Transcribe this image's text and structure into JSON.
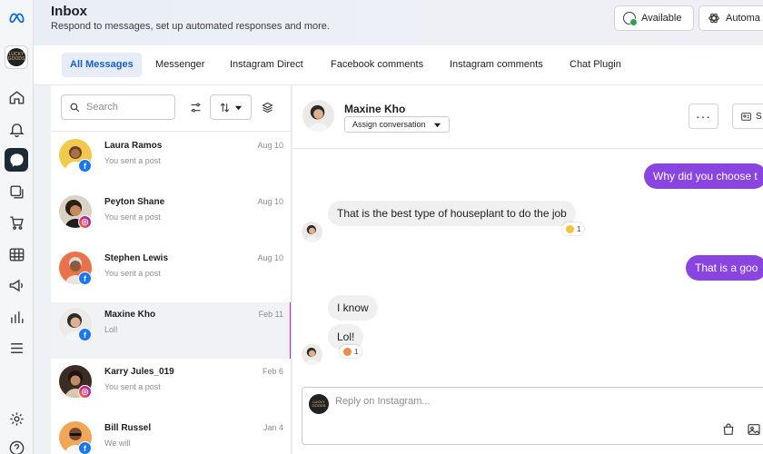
{
  "header": {
    "title": "Inbox",
    "subtitle": "Respond to messages, set up automated responses and more.",
    "available_label": "Available",
    "automations_label": "Automa"
  },
  "sidebar": {
    "brand_avatar_text": "LUCKY GOODS",
    "items": [
      "meta-logo",
      "home",
      "notifications",
      "inbox",
      "posts",
      "shop",
      "planner",
      "ads",
      "insights",
      "menu",
      "settings",
      "help"
    ]
  },
  "tabs": [
    {
      "label": "All Messages",
      "active": true
    },
    {
      "label": "Messenger"
    },
    {
      "label": "Instagram Direct"
    },
    {
      "label": "Facebook comments"
    },
    {
      "label": "Instagram comments"
    },
    {
      "label": "Chat Plugin"
    }
  ],
  "list": {
    "search_placeholder": "Search",
    "conversations": [
      {
        "name": "Laura Ramos",
        "preview": "You sent a post",
        "date": "Aug 10",
        "platform": "facebook"
      },
      {
        "name": "Peyton Shane",
        "preview": "You sent a post",
        "date": "Aug 10",
        "platform": "instagram"
      },
      {
        "name": "Stephen Lewis",
        "preview": "You sent a post",
        "date": "Aug 10",
        "platform": "facebook"
      },
      {
        "name": "Maxine Kho",
        "preview": "Lol!",
        "date": "Feb 11",
        "platform": "facebook",
        "selected": true
      },
      {
        "name": "Karry Jules_019",
        "preview": "You sent a post",
        "date": "Feb 6",
        "platform": "instagram"
      },
      {
        "name": "Bill Russel",
        "preview": "We will",
        "date": "Jan 4",
        "platform": "facebook"
      }
    ]
  },
  "chat": {
    "contact_name": "Maxine Kho",
    "assign_label": "Assign conversation",
    "side_button_label": "S",
    "messages": [
      {
        "from": "me",
        "text": "Why did you choose t"
      },
      {
        "from": "them",
        "text": "That is the best type of houseplant to do the job",
        "reaction_count": "1"
      },
      {
        "from": "me",
        "text": "That is a goo"
      },
      {
        "from": "them",
        "text": "I know"
      },
      {
        "from": "them",
        "text": "Lol!",
        "reaction_count": "1"
      }
    ],
    "reply_placeholder": "Reply on Instagram...",
    "composer_avatar_text": "LUCKY GOODS"
  },
  "colors": {
    "accent": "#1b5cc4",
    "outgoing_bubble": "#8a44e0",
    "facebook": "#1877f2",
    "selected_indicator": "#a033c4"
  }
}
